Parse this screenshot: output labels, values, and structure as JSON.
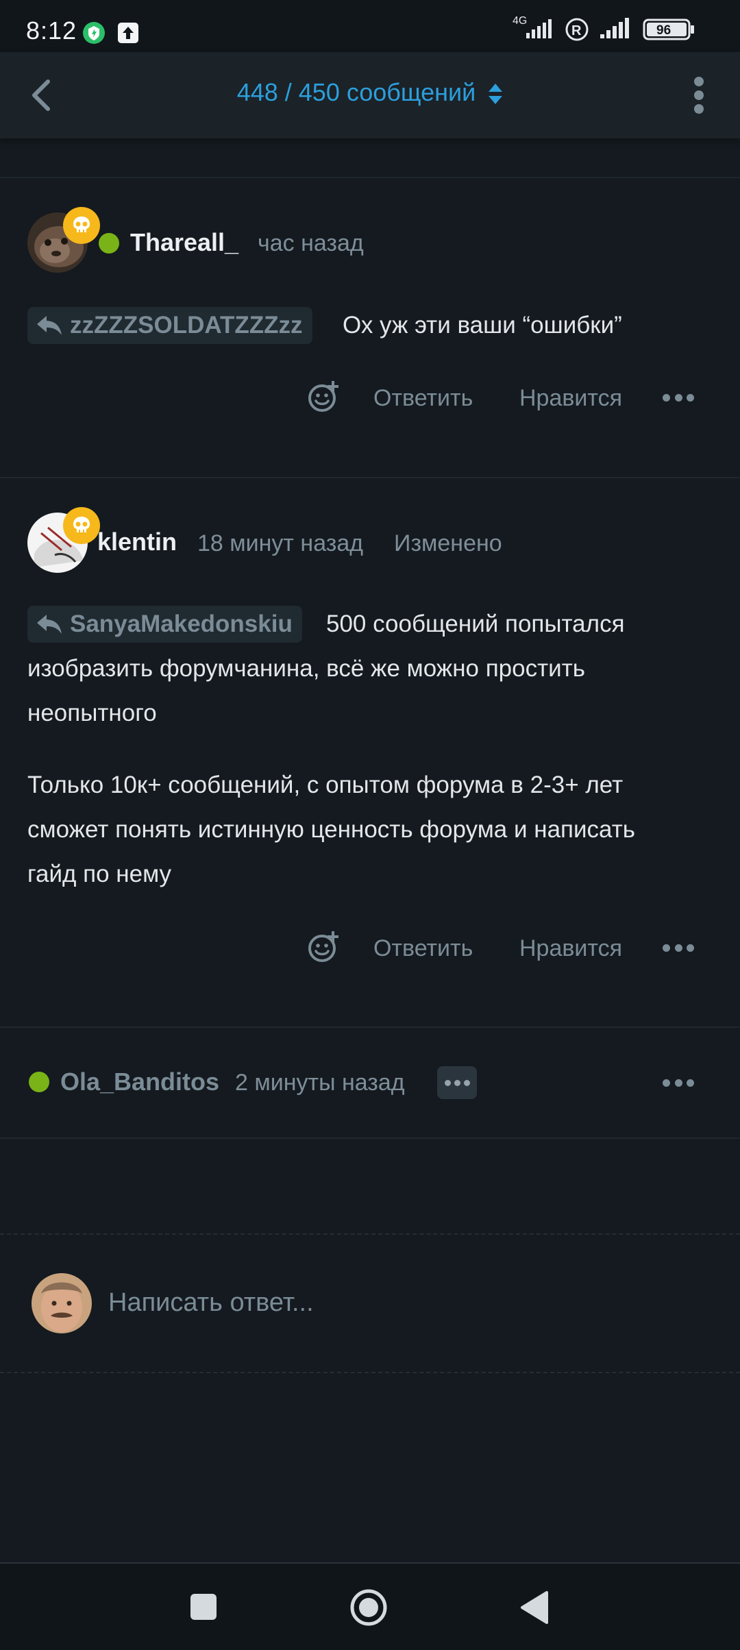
{
  "status_bar": {
    "time": "8:12",
    "network": "4G",
    "battery": "96"
  },
  "header": {
    "title": "448 / 450 сообщений"
  },
  "posts": [
    {
      "username": "Thareall_",
      "time": "час назад",
      "online": true,
      "badge": "skull-icon",
      "reply_to": "zzZZZSOLDATZZZzz",
      "text_inline": "Ох уж эти ваши “ошибки”"
    },
    {
      "username": "klentin",
      "time": "18 минут назад",
      "edited": "Изменено",
      "badge": "skull-icon",
      "reply_to": "SanyaMakedonskiu",
      "text_lines": [
        "500 сообщений попытался",
        "изобразить форумчанина, всё же можно простить",
        "неопытного"
      ],
      "paragraph2_lines": [
        "Только 10к+ сообщений, с опытом форума в 2-3+ лет",
        "сможет понять истинную ценность форума и написать",
        "гайд по нему"
      ]
    },
    {
      "username": "Ola_Banditos",
      "time": "2 минуты назад",
      "online": true,
      "typing": true
    }
  ],
  "actions": {
    "reply": "Ответить",
    "like": "Нравится"
  },
  "composer": {
    "placeholder": "Написать ответ..."
  },
  "colors": {
    "background": "#141a1f",
    "accent": "#2c9fdc",
    "online": "#7ab317",
    "badge": "#f6b81b"
  }
}
